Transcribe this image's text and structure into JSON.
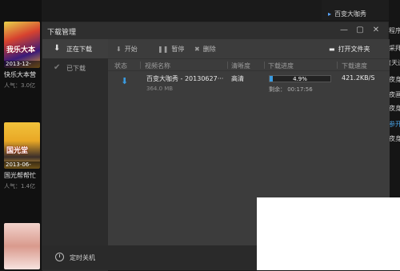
{
  "window": {
    "title": "下载管理"
  },
  "sidebar": {
    "items": [
      {
        "label": "正在下载",
        "icon": "download-arrow-icon"
      },
      {
        "label": "已下载",
        "icon": "check-icon"
      }
    ]
  },
  "toolbar": {
    "start_label": "开始",
    "pause_label": "暂停",
    "delete_label": "删除",
    "open_folder_label": "打开文件夹"
  },
  "table": {
    "headers": [
      "状态",
      "视频名称",
      "清晰度",
      "下载进度",
      "下载速度"
    ],
    "rows": [
      {
        "name": "百变大咖秀 - 20130627···",
        "size": "364.0 MB",
        "quality": "高清",
        "progress_text": "4.9%",
        "progress": 0.049,
        "remaining": "剩余： 00:17:56",
        "speed": "421.2KB/S"
      }
    ]
  },
  "footer": {
    "shutdown_label": "定时关机"
  },
  "background": {
    "top_right_crumb": "百变大咖秀",
    "right_items": [
      "程序",
      "采拜",
      "(天运",
      "夜身",
      "夜画",
      "夜身",
      "参开",
      "夜身"
    ],
    "left_items": [
      {
        "date": "2013-12-",
        "overlay": "我乐大本",
        "title": "快乐大本营",
        "pop": "人气：3.0亿"
      },
      {
        "date": "2013-06-",
        "overlay": "国光堂",
        "title": "国光帮帮忙",
        "pop": "人气：1.4亿"
      },
      {
        "date": "",
        "overlay": "",
        "title": "",
        "pop": ""
      }
    ]
  },
  "colors": {
    "accent": "#3a9be0",
    "dialog_bg": "#3a3a3a"
  }
}
